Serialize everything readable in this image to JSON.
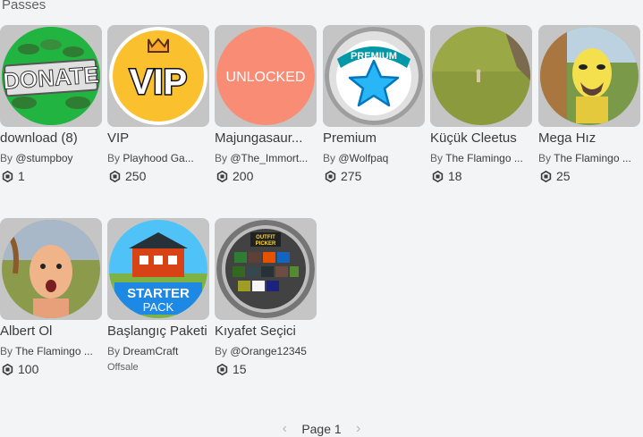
{
  "section": {
    "title": "Passes"
  },
  "passes": [
    {
      "name": "download (8)",
      "by": "By ",
      "creator": "@stumpboy",
      "price": "1",
      "thumb_text": "DONATE"
    },
    {
      "name": "VIP",
      "by": "By ",
      "creator": "Playhood Ga...",
      "price": "250",
      "thumb_text": "VIP"
    },
    {
      "name": "Majungasaur...",
      "by": "By ",
      "creator": "@The_Immort...",
      "price": "200",
      "thumb_text": "UNLOCKED"
    },
    {
      "name": "Premium",
      "by": "By ",
      "creator": "@Wolfpaq",
      "price": "275",
      "thumb_text": "PREMIUM"
    },
    {
      "name": "Küçük Cleetus",
      "by": "By ",
      "creator": "The Flamingo ...",
      "price": "18",
      "thumb_text": ""
    },
    {
      "name": "Mega Hız",
      "by": "By ",
      "creator": "The Flamingo ...",
      "price": "25",
      "thumb_text": ""
    },
    {
      "name": "Albert Ol",
      "by": "By ",
      "creator": "The Flamingo ...",
      "price": "100",
      "thumb_text": ""
    },
    {
      "name": "Başlangıç Paketi",
      "by": "By ",
      "creator": "DreamCraft",
      "price": "",
      "status": "Offsale",
      "thumb_text": "STARTER PACK"
    },
    {
      "name": "Kıyafet Seçici",
      "by": "By ",
      "creator": "@Orange12345",
      "price": "15",
      "thumb_text": "OUTFIT PICKER"
    }
  ],
  "pagination": {
    "label": "Page 1",
    "prev_icon": "chevron-left-icon",
    "next_icon": "chevron-right-icon"
  }
}
